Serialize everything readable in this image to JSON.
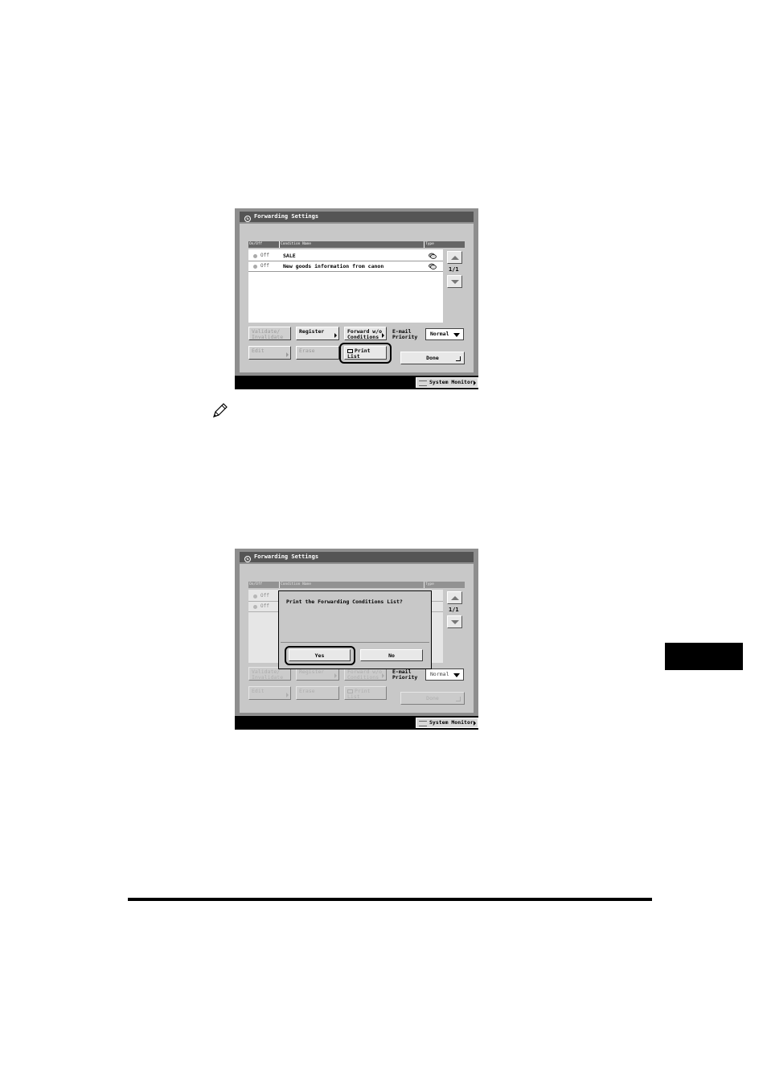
{
  "screen1": {
    "title": "Forwarding Settings",
    "columns": {
      "onoff": "On/Off",
      "condition": "Condition Name",
      "type": "Type"
    },
    "rows": [
      {
        "status": "Off",
        "name": "SALE"
      },
      {
        "status": "Off",
        "name": "New goods information from canon"
      }
    ],
    "page": "1/1",
    "buttons": {
      "validate": "Validate/ Invalidate",
      "register": "Register",
      "forward": "Forward w/o Conditions",
      "edit": "Edit",
      "erase": "Erase",
      "print_list": "Print List",
      "done": "Done"
    },
    "priority_label": "E-mail Priority",
    "priority_value": "Normal",
    "system_monitor": "System Monitor"
  },
  "screen2": {
    "title": "Forwarding Settings",
    "columns": {
      "onoff": "On/Off",
      "condition": "Condition Name",
      "type": "Type"
    },
    "rows": [
      {
        "status": "Off"
      },
      {
        "status": "Off"
      }
    ],
    "page": "1/1",
    "buttons": {
      "validate": "Validate/ Invalidate",
      "register": "Register",
      "forward": "Forward w/o Conditions",
      "edit": "Edit",
      "erase": "Erase",
      "print_list": "Print List",
      "done": "Done"
    },
    "priority_label": "E-mail Priority",
    "priority_value": "Normal",
    "system_monitor": "System Monitor",
    "dialog": {
      "message": "Print the Forwarding Conditions List?",
      "yes": "Yes",
      "no": "No"
    }
  },
  "icons": {
    "note": "pencil-icon",
    "title": "forwarding-icon",
    "type": "email-type-icon"
  }
}
